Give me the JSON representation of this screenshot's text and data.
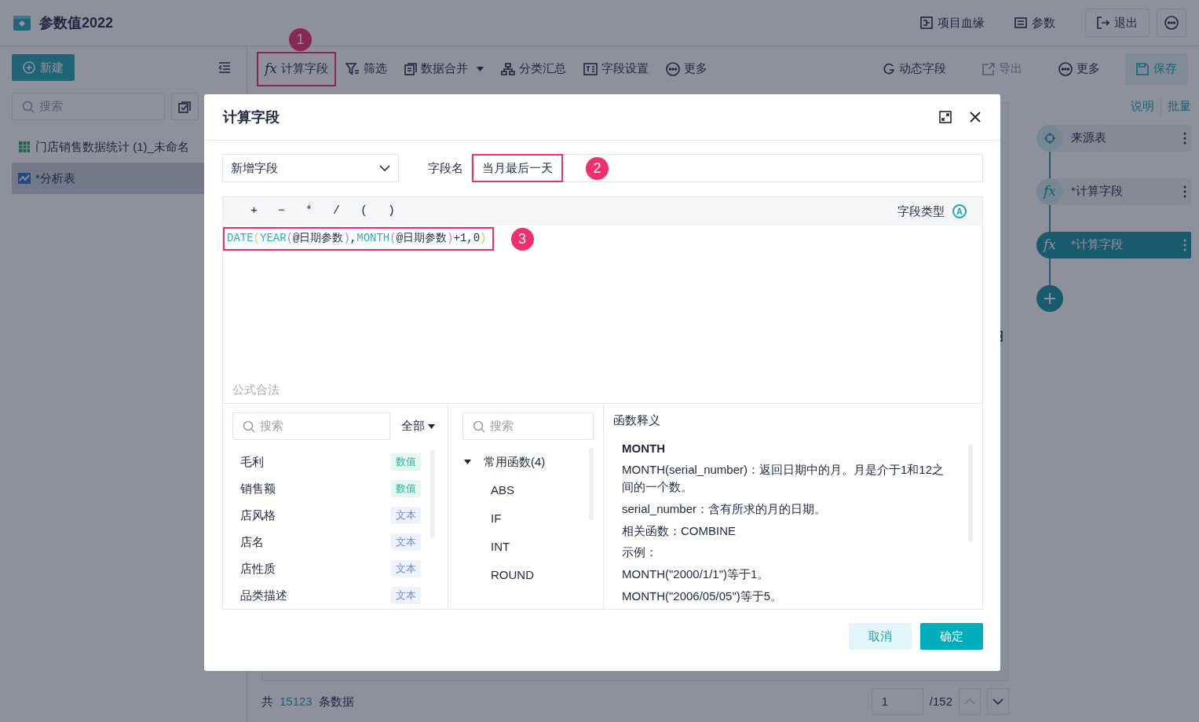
{
  "app": {
    "title": "参数值2022",
    "header_actions": [
      {
        "label": "项目血缘"
      },
      {
        "label": "参数"
      }
    ],
    "exit_button": "退出"
  },
  "sidebar": {
    "new_button": "新建",
    "search": {
      "placeholder": "搜索"
    },
    "items": [
      {
        "label": "门店销售数据统计 (1)_未命名",
        "kind": "table",
        "selected": false
      },
      {
        "label": "*分析表",
        "kind": "analysis",
        "selected": true
      }
    ]
  },
  "toolbar": {
    "left": [
      {
        "label": "计算字段",
        "icon_text": "fx",
        "dropdown": false,
        "highlighted": true,
        "callout": "1"
      },
      {
        "label": "筛选",
        "dropdown": false,
        "highlighted": false
      },
      {
        "label": "数据合并",
        "dropdown": true,
        "highlighted": false
      },
      {
        "label": "分类汇总",
        "dropdown": false,
        "highlighted": false
      },
      {
        "label": "字段设置",
        "dropdown": false,
        "highlighted": false
      },
      {
        "label": "更多",
        "dropdown": false,
        "highlighted": false
      }
    ],
    "right": [
      {
        "label": "动态字段",
        "disabled": false
      },
      {
        "label": "导出",
        "disabled": true
      },
      {
        "label": "更多",
        "disabled": false
      }
    ],
    "save_button": "保存"
  },
  "steps_panel": {
    "links": [
      "说明",
      "批量"
    ],
    "steps": [
      {
        "label": "来源表",
        "selected": false
      },
      {
        "label": "*计算字段",
        "icon_text": "fx",
        "selected": false
      },
      {
        "label": "*计算字段",
        "icon_text": "fx",
        "selected": true
      }
    ]
  },
  "footer": {
    "prefix": "共",
    "count": "15123",
    "suffix": "条数据",
    "page": "1",
    "total_pages": "/152"
  },
  "dialog": {
    "title": "计算字段",
    "mode_select": "新增字段",
    "name_label": "字段名",
    "name_value": "当月最后一天",
    "name_highlighted": true,
    "name_callout": "2",
    "operators": [
      "+",
      "−",
      "*",
      "/",
      "(",
      ")"
    ],
    "field_type_label": "字段类型",
    "field_type_icon": "A",
    "formula": {
      "highlighted": true,
      "callout": "3",
      "tokens": [
        {
          "text": "DATE",
          "kind": "function"
        },
        {
          "text": "(",
          "kind": "outer"
        },
        {
          "text": "YEAR",
          "kind": "function"
        },
        {
          "text": "(",
          "kind": "inner"
        },
        {
          "text": "@日期参数",
          "kind": "plain"
        },
        {
          "text": ")",
          "kind": "inner"
        },
        {
          "text": ",",
          "kind": "plain"
        },
        {
          "text": "MONTH",
          "kind": "function"
        },
        {
          "text": "(",
          "kind": "inner"
        },
        {
          "text": "@日期参数",
          "kind": "plain"
        },
        {
          "text": ")",
          "kind": "inner"
        },
        {
          "text": "+1,0",
          "kind": "plain"
        },
        {
          "text": ")",
          "kind": "outer"
        }
      ]
    },
    "status": "公式合法",
    "fields": {
      "search": {
        "placeholder": "搜索"
      },
      "filter": "全部",
      "items": [
        {
          "name": "毛利",
          "type": "数值",
          "kind": "number"
        },
        {
          "name": "销售额",
          "type": "数值",
          "kind": "number"
        },
        {
          "name": "店风格",
          "type": "文本",
          "kind": "text"
        },
        {
          "name": "店名",
          "type": "文本",
          "kind": "text"
        },
        {
          "name": "店性质",
          "type": "文本",
          "kind": "text"
        },
        {
          "name": "品类描述",
          "type": "文本",
          "kind": "text"
        }
      ]
    },
    "functions": {
      "search": {
        "placeholder": "搜索"
      },
      "groups": [
        {
          "label": "常用函数(4)",
          "expanded": true,
          "children": [
            {
              "label": "ABS"
            },
            {
              "label": "IF"
            },
            {
              "label": "INT"
            },
            {
              "label": "ROUND"
            }
          ]
        }
      ]
    },
    "description": {
      "heading": "函数释义",
      "name": "MONTH",
      "lines": [
        "MONTH(serial_number)：返回日期中的月。月是介于1和12之间的一个数。",
        "serial_number：含有所求的月的日期。",
        "相关函数：COMBINE",
        "示例：",
        "MONTH(\"2000/1/1\")等于1。",
        "MONTH(\"2006/05/05\")等于5。"
      ]
    },
    "cancel_button": "取消",
    "ok_button": "确定"
  }
}
